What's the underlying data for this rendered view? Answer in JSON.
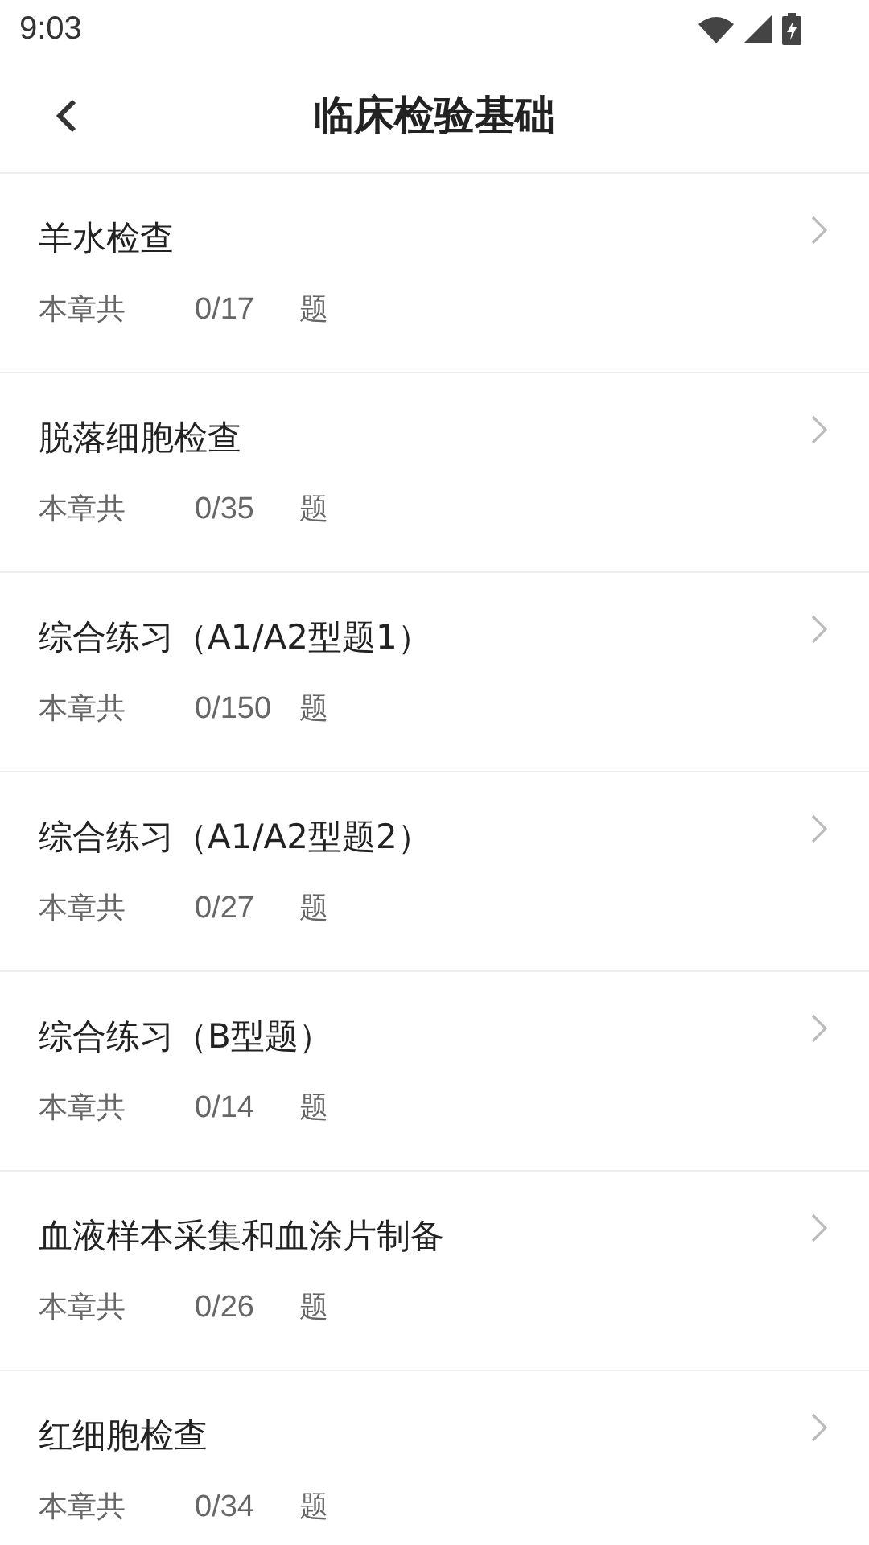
{
  "status_bar": {
    "time": "9:03"
  },
  "header": {
    "title": "临床检验基础"
  },
  "chapters": [
    {
      "title": "羊水检查",
      "prefix": "本章共",
      "count": "0/17",
      "suffix": "题"
    },
    {
      "title": "脱落细胞检查",
      "prefix": "本章共",
      "count": "0/35",
      "suffix": "题"
    },
    {
      "title": "综合练习（A1/A2型题1）",
      "prefix": "本章共",
      "count": "0/150",
      "suffix": "题"
    },
    {
      "title": "综合练习（A1/A2型题2）",
      "prefix": "本章共",
      "count": "0/27",
      "suffix": "题"
    },
    {
      "title": "综合练习（B型题）",
      "prefix": "本章共",
      "count": "0/14",
      "suffix": "题"
    },
    {
      "title": "血液样本采集和血涂片制备",
      "prefix": "本章共",
      "count": "0/26",
      "suffix": "题"
    },
    {
      "title": "红细胞检查",
      "prefix": "本章共",
      "count": "0/34",
      "suffix": "题"
    }
  ]
}
